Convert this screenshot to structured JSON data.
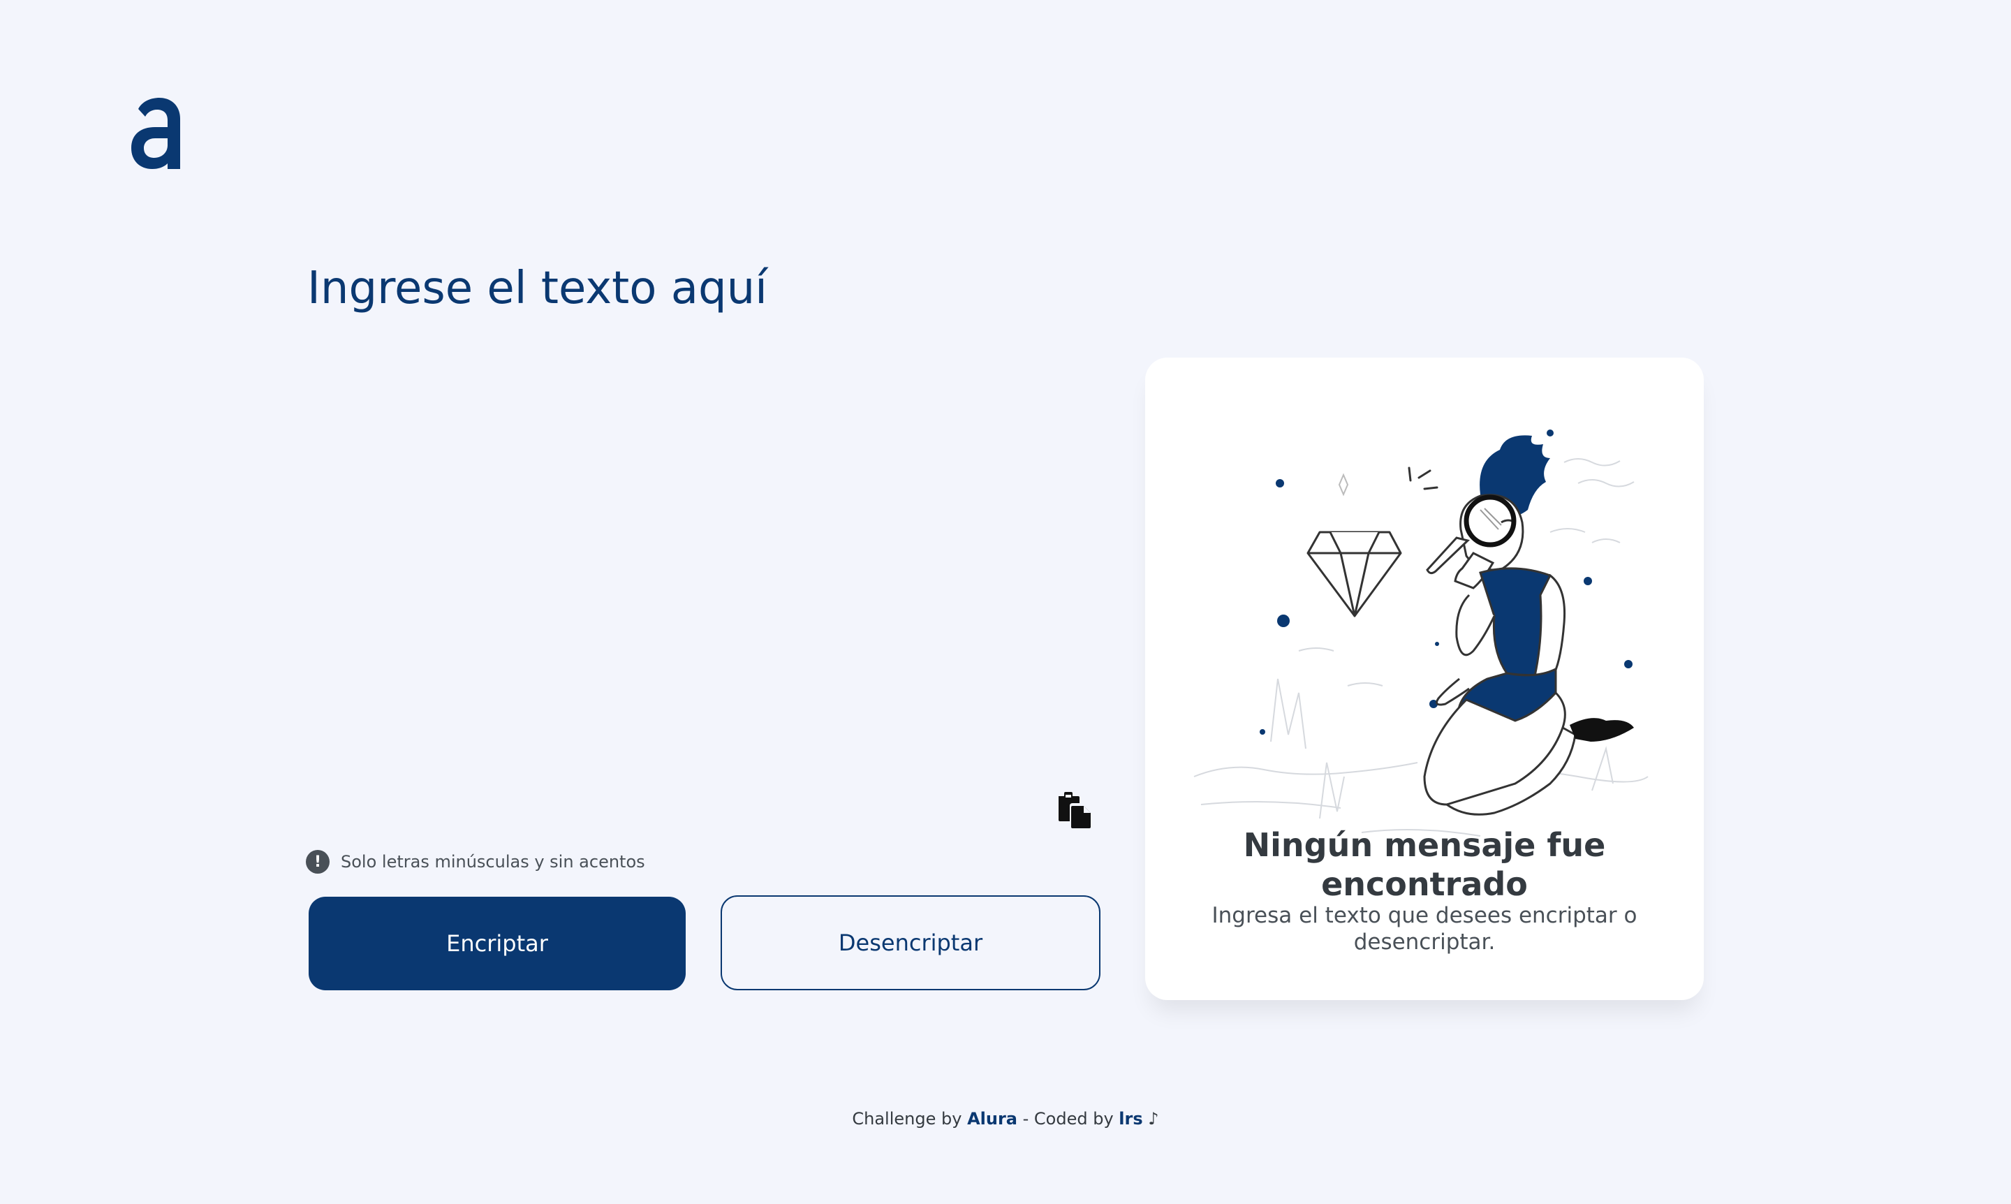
{
  "logo": {
    "letter": "a",
    "icon": "alura-logo-icon",
    "color": "#0a3871"
  },
  "input": {
    "placeholder": "Ingrese el texto aquí",
    "value": ""
  },
  "paste_button": {
    "icon": "clipboard-paste-icon"
  },
  "hint": {
    "icon": "exclamation-circle-icon",
    "text": "Solo letras minúsculas y sin acentos"
  },
  "buttons": {
    "encrypt_label": "Encriptar",
    "decrypt_label": "Desencriptar"
  },
  "result_panel": {
    "illustration": "person-with-magnifying-glass-illustration",
    "title": "Ningún mensaje fue encontrado",
    "subtitle": "Ingresa el texto que desees encriptar o desencriptar."
  },
  "footer": {
    "challenge_prefix": "Challenge by",
    "challenge_brand": "Alura",
    "separator": " - ",
    "coded_prefix": "Coded by",
    "author": "lrs",
    "note": "♪"
  },
  "colors": {
    "primary": "#0a3871",
    "background": "#f3f5fc",
    "card": "#ffffff",
    "text_dark": "#343a40",
    "text_muted": "#495057"
  }
}
